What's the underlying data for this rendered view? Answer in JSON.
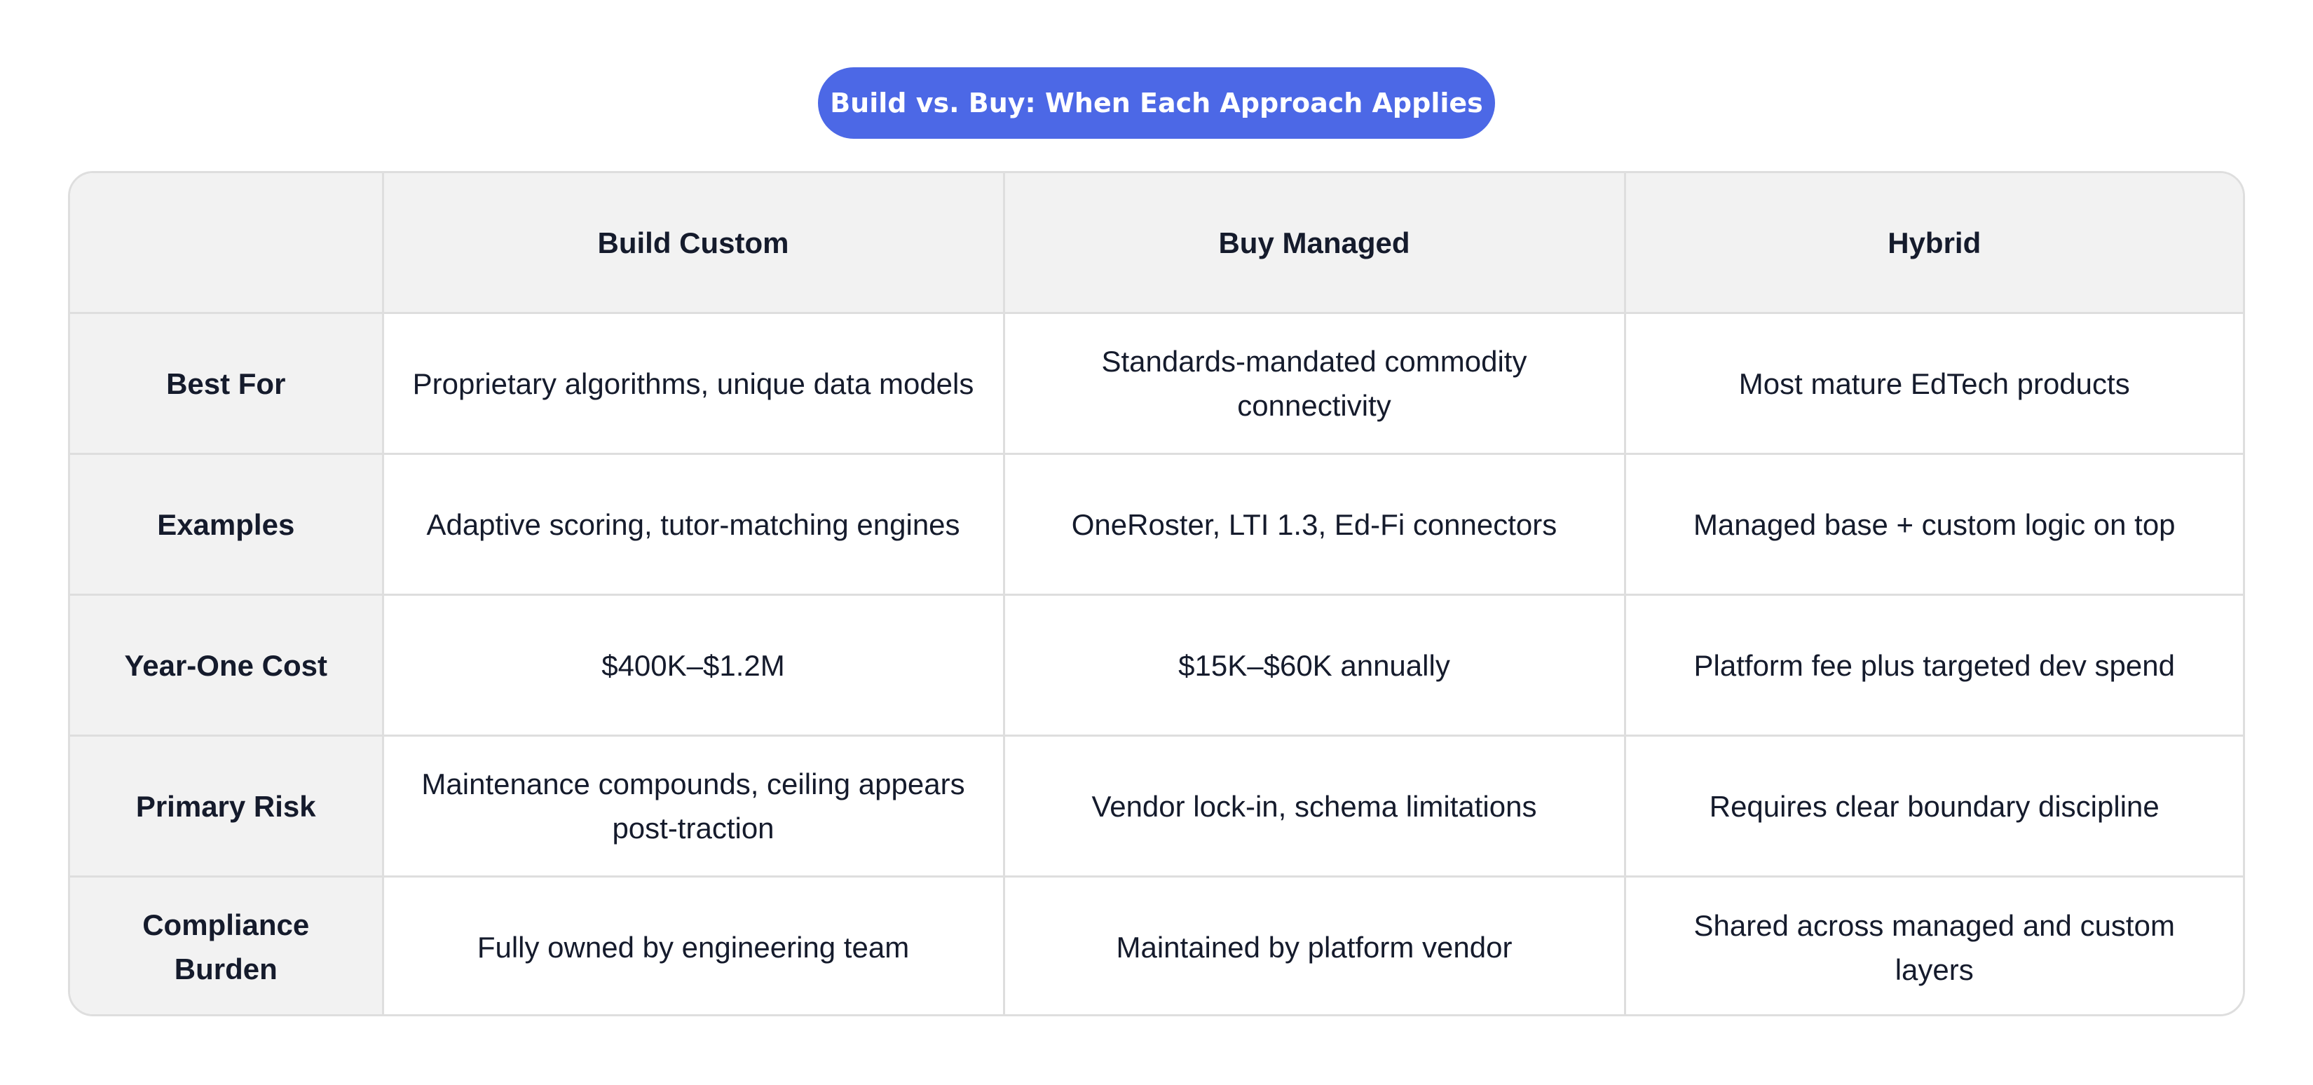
{
  "title": "Build vs. Buy: When Each Approach Applies",
  "table": {
    "corner": "",
    "columns": [
      "Build Custom",
      "Buy Managed",
      "Hybrid"
    ],
    "rows": [
      {
        "label": "Best For",
        "cells": [
          "Proprietary algorithms, unique data models",
          "Standards-mandated commodity connectivity",
          "Most mature EdTech products"
        ]
      },
      {
        "label": "Examples",
        "cells": [
          "Adaptive scoring, tutor-matching engines",
          "OneRoster, LTI 1.3, Ed-Fi connectors",
          "Managed base + custom logic on top"
        ]
      },
      {
        "label": "Year-One Cost",
        "cells": [
          "$400K–$1.2M",
          "$15K–$60K annually",
          "Platform fee plus targeted dev spend"
        ]
      },
      {
        "label": "Primary Risk",
        "cells": [
          "Maintenance compounds, ceiling appears post-traction",
          "Vendor lock-in, schema limitations",
          "Requires clear boundary discipline"
        ]
      },
      {
        "label": "Compliance Burden",
        "cells": [
          "Fully owned by engineering team",
          "Maintained by platform vendor",
          "Shared across managed and custom layers"
        ]
      }
    ]
  },
  "colors": {
    "accent": "#4c68e6",
    "header_bg": "#f2f2f2",
    "border": "#dedede",
    "text": "#151b2c"
  }
}
